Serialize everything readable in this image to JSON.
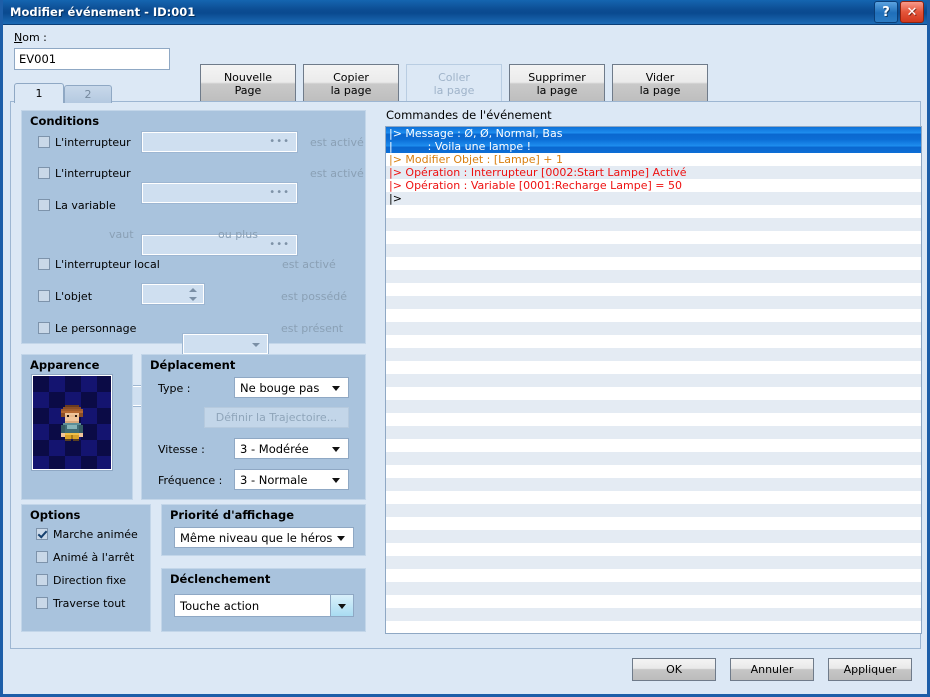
{
  "window": {
    "title": "Modifier événement - ID:001",
    "help_icon": "?",
    "close_icon": "✕"
  },
  "top": {
    "name_label": "Nom :",
    "name_value": "EV001",
    "buttons": [
      {
        "line1": "Nouvelle",
        "line2": "Page",
        "disabled": false
      },
      {
        "line1": "Copier",
        "line2": "la page",
        "disabled": false
      },
      {
        "line1": "Coller",
        "line2": "la page",
        "disabled": true
      },
      {
        "line1": "Supprimer",
        "line2": "la page",
        "disabled": false
      },
      {
        "line1": "Vider",
        "line2": "la page",
        "disabled": false
      }
    ]
  },
  "tabs": [
    {
      "label": "1",
      "active": true
    },
    {
      "label": "2",
      "active": false
    }
  ],
  "conditions": {
    "title": "Conditions",
    "rows": [
      {
        "label": "L'interrupteur",
        "checked": false,
        "field": "",
        "suffix": "est activé",
        "control": "dots"
      },
      {
        "label": "L'interrupteur",
        "checked": false,
        "field": "",
        "suffix": "est activé",
        "control": "dots"
      },
      {
        "label": "La variable",
        "checked": false,
        "field": "",
        "suffix": "",
        "control": "dots"
      },
      {
        "label": "vaut",
        "checked": null,
        "field": "",
        "suffix": "ou plus",
        "control": "spin"
      },
      {
        "label": "L'interrupteur local",
        "checked": false,
        "field": "",
        "suffix": "est activé",
        "control": "arrow"
      },
      {
        "label": "L'objet",
        "checked": false,
        "field": "",
        "suffix": "est possédé",
        "control": "arrow"
      },
      {
        "label": "Le personnage",
        "checked": false,
        "field": "",
        "suffix": "est présent",
        "control": "arrow"
      }
    ]
  },
  "apparence": {
    "title": "Apparence",
    "sprite_alt": "character-sprite"
  },
  "deplacement": {
    "title": "Déplacement",
    "type_label": "Type :",
    "type_value": "Ne bouge pas",
    "trajectory_button": "Définir la Trajectoire...",
    "vitesse_label": "Vitesse :",
    "vitesse_value": "3 - Modérée",
    "frequence_label": "Fréquence :",
    "frequence_value": "3 - Normale"
  },
  "options": {
    "title": "Options",
    "items": [
      {
        "label": "Marche animée",
        "checked": true
      },
      {
        "label": "Animé à l'arrêt",
        "checked": false
      },
      {
        "label": "Direction fixe",
        "checked": false
      },
      {
        "label": "Traverse tout",
        "checked": false
      }
    ]
  },
  "priorite": {
    "title": "Priorité d'affichage",
    "value": "Même niveau que le héros"
  },
  "declenchement": {
    "title": "Déclenchement",
    "value": "Touche action"
  },
  "commands": {
    "title": "Commandes de l'événement",
    "rows": [
      {
        "text": "|> Message : Ø, Ø, Normal, Bas",
        "style": "selected"
      },
      {
        "text": "|          : Voila une lampe !",
        "style": "selected"
      },
      {
        "text": "|> Modifier Objet : [Lampe] + 1",
        "style": "orange"
      },
      {
        "text": "|> Opération : Interrupteur [0002:Start Lampe] Activé",
        "style": "red"
      },
      {
        "text": "|> Opération : Variable [0001:Recharge Lampe] = 50",
        "style": "red"
      },
      {
        "text": "|>",
        "style": "normal"
      }
    ],
    "colors": {
      "orange": "#d98010",
      "red": "#ee1111",
      "normal": "#000000",
      "selection": "#0d70d8"
    }
  },
  "footer": {
    "ok": "OK",
    "cancel": "Annuler",
    "apply": "Appliquer"
  }
}
